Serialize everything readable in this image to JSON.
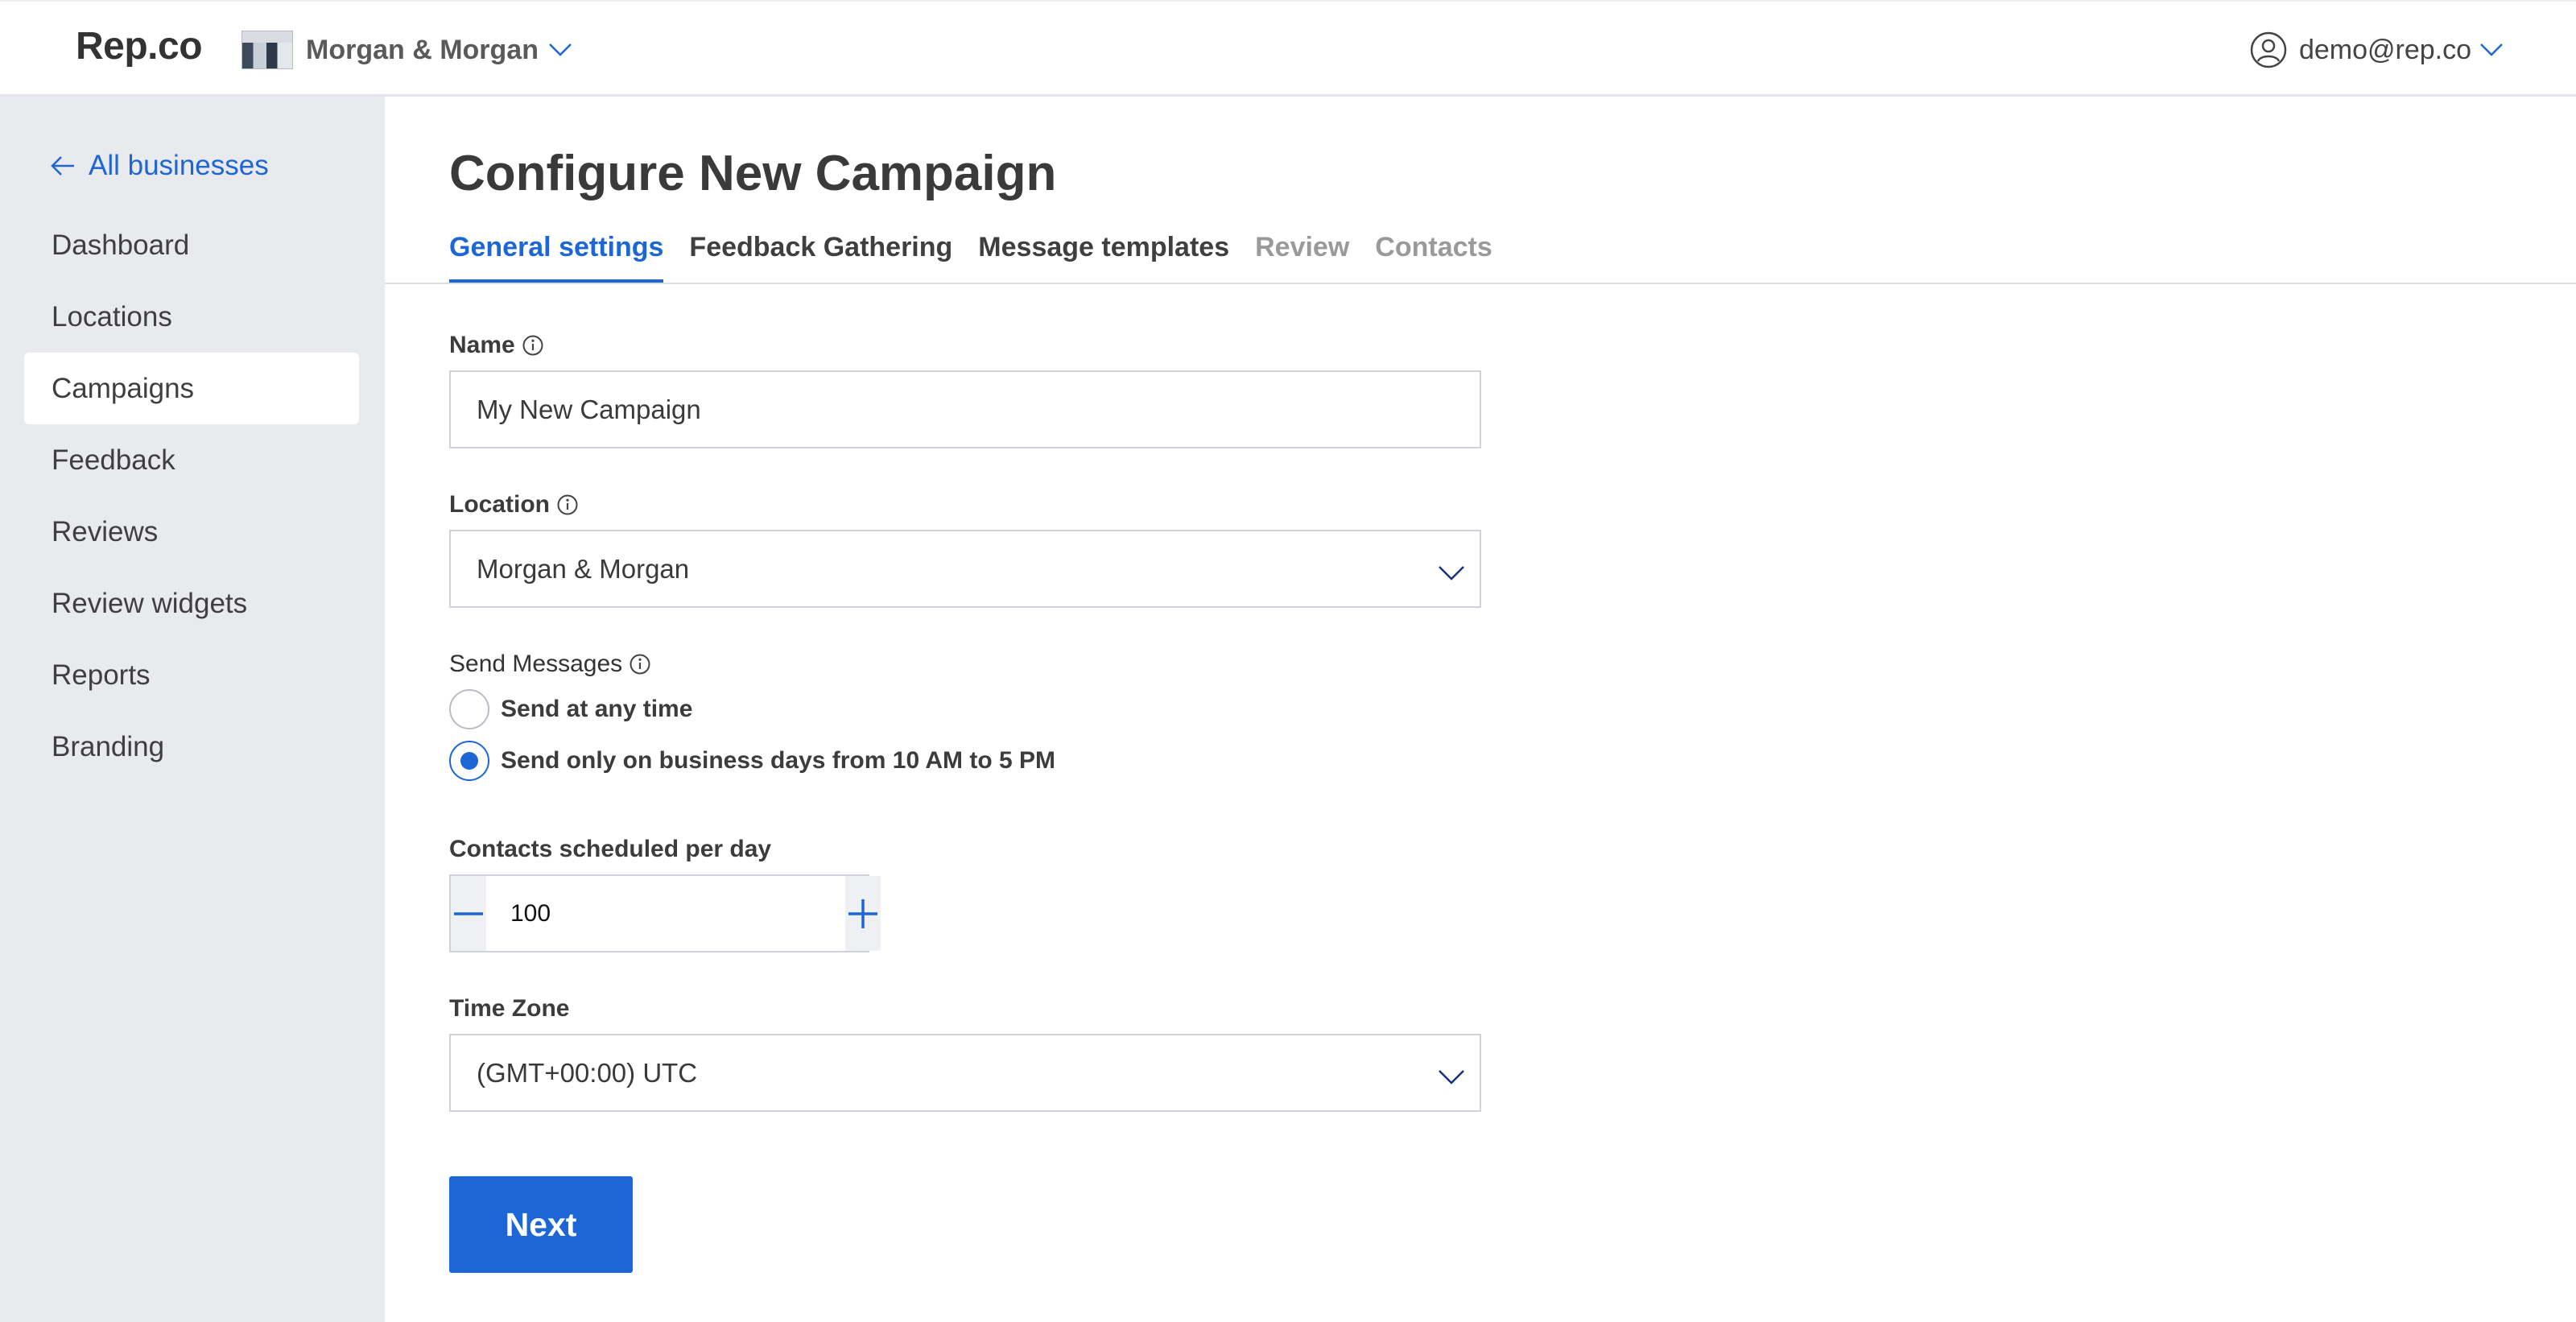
{
  "app": {
    "logo": "Rep.co"
  },
  "header": {
    "business_name": "Morgan & Morgan",
    "user_email": "demo@rep.co"
  },
  "sidebar": {
    "back_label": "All businesses",
    "items": [
      {
        "label": "Dashboard",
        "active": false
      },
      {
        "label": "Locations",
        "active": false
      },
      {
        "label": "Campaigns",
        "active": true
      },
      {
        "label": "Feedback",
        "active": false
      },
      {
        "label": "Reviews",
        "active": false
      },
      {
        "label": "Review widgets",
        "active": false
      },
      {
        "label": "Reports",
        "active": false
      },
      {
        "label": "Branding",
        "active": false
      }
    ]
  },
  "page": {
    "title": "Configure New Campaign",
    "tabs": [
      {
        "label": "General settings",
        "state": "active"
      },
      {
        "label": "Feedback Gathering",
        "state": "enabled"
      },
      {
        "label": "Message templates",
        "state": "enabled"
      },
      {
        "label": "Review",
        "state": "disabled"
      },
      {
        "label": "Contacts",
        "state": "disabled"
      }
    ]
  },
  "form": {
    "name": {
      "label": "Name",
      "value": "My New Campaign"
    },
    "location": {
      "label": "Location",
      "value": "Morgan & Morgan"
    },
    "send_messages": {
      "label": "Send Messages",
      "options": [
        {
          "label": "Send at any time",
          "selected": false
        },
        {
          "label": "Send only on business days from 10 AM to 5 PM",
          "selected": true
        }
      ]
    },
    "contacts_per_day": {
      "label": "Contacts scheduled per day",
      "value": "100"
    },
    "time_zone": {
      "label": "Time Zone",
      "value": "(GMT+00:00) UTC"
    },
    "next_label": "Next"
  },
  "icons": {
    "business_switch_chevron": "chevron-down-icon",
    "user": "user-circle-icon",
    "back": "arrow-left-icon",
    "info": "info-icon",
    "select_chevron": "chevron-down-icon",
    "minus": "minus-icon",
    "plus": "plus-icon"
  },
  "colors": {
    "accent": "#1d66d6",
    "sidebar_bg": "#e8eaee",
    "disabled_text": "#9a9a9a"
  }
}
